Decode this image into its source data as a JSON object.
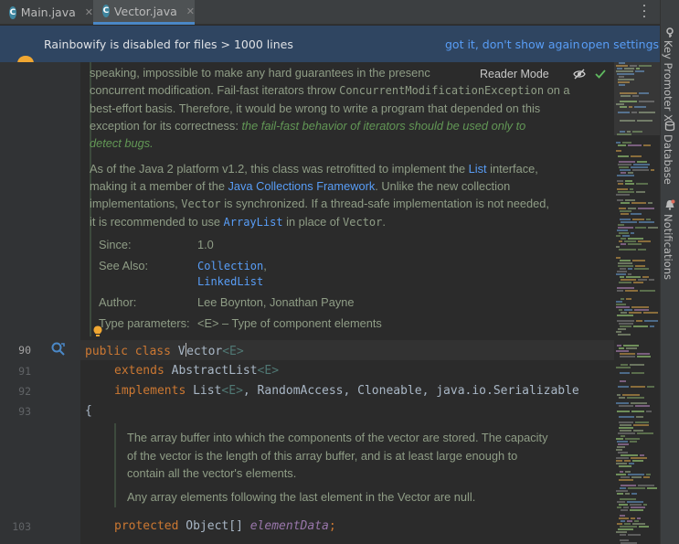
{
  "tabs": [
    {
      "label": "Main.java",
      "icon": "java-class-icon"
    },
    {
      "label": "Vector.java",
      "icon": "java-class-icon",
      "active": true
    }
  ],
  "banner": {
    "message": "Rainbowify is disabled for files > 1000 lines",
    "dismiss": "got it, don't show again",
    "settings": "open settings"
  },
  "side_tools": [
    "Key Promoter X",
    "Database",
    "Notifications"
  ],
  "reader_mode": {
    "label": "Reader Mode"
  },
  "doc": {
    "p1_lines": [
      "speaking, impossible to make any hard guarantees in the presenc",
      "concurrent modification. Fail-fast iterators throw ",
      "ConcurrentModificationException",
      " on a",
      "best-effort basis. Therefore, it would be wrong to write a program that depended on this",
      "exception for its correctness: ",
      "the fail-fast behavior of iterators should be used only to",
      "detect bugs."
    ],
    "p2_lines": {
      "a1": "As of the Java 2 platform v1.2, this class was retrofitted to implement the ",
      "a2": "List",
      "a3": " interface,",
      "b1": "making it a member of the ",
      "b2": "Java Collections Framework",
      "b3": ". Unlike the new collection",
      "c1": "implementations, ",
      "c2": "Vector",
      "c3": " is synchronized. If a thread-safe implementation is not needed,",
      "d1": "it is recommended to use ",
      "d2": "ArrayList",
      "d3": " in place of ",
      "d4": "Vector",
      "d5": "."
    },
    "since_key": "Since:",
    "since_val": "1.0",
    "see_key": "See Also:",
    "see_1": "Collection",
    "see_1_suffix": ",",
    "see_2": "LinkedList",
    "author_key": "Author:",
    "author_val": "Lee Boynton, Jonathan Payne",
    "type_key": "Type parameters:",
    "type_val": "<E> – Type of component elements"
  },
  "lines": {
    "l90": "90",
    "l91": "91",
    "l92": "92",
    "l93": "93",
    "l103": "103"
  },
  "code": {
    "c90_kw1": "public",
    "c90_kw2": "class",
    "c90_name1": "V",
    "c90_name2": "ector",
    "c90_gen": "<E>",
    "c91_kw": "extends",
    "c91_name": " AbstractList",
    "c91_gen": "<E>",
    "c92_kw": "implements",
    "c92_name": " List",
    "c92_gen": "<E>",
    "c92_rest": ", RandomAccess, Cloneable, java.io.Serializable",
    "c93": "{",
    "c103_kw": "protected",
    "c103_type": " Object[] ",
    "c103_field": "elementData",
    "c103_end": ";"
  },
  "inner_doc": {
    "l1": "The array buffer into which the components of the vector are stored. The capacity",
    "l2": "of the vector is the length of this array buffer, and is at least large enough to",
    "l3": "contain all the vector's elements.",
    "l4": "Any array elements following the last element in the Vector are null."
  },
  "colors": {
    "accent": "#4a88c7",
    "banner_bg": "#2f4561",
    "link": "#589df6",
    "keyword": "#cc7832",
    "doc_text": "#8f9d86"
  }
}
